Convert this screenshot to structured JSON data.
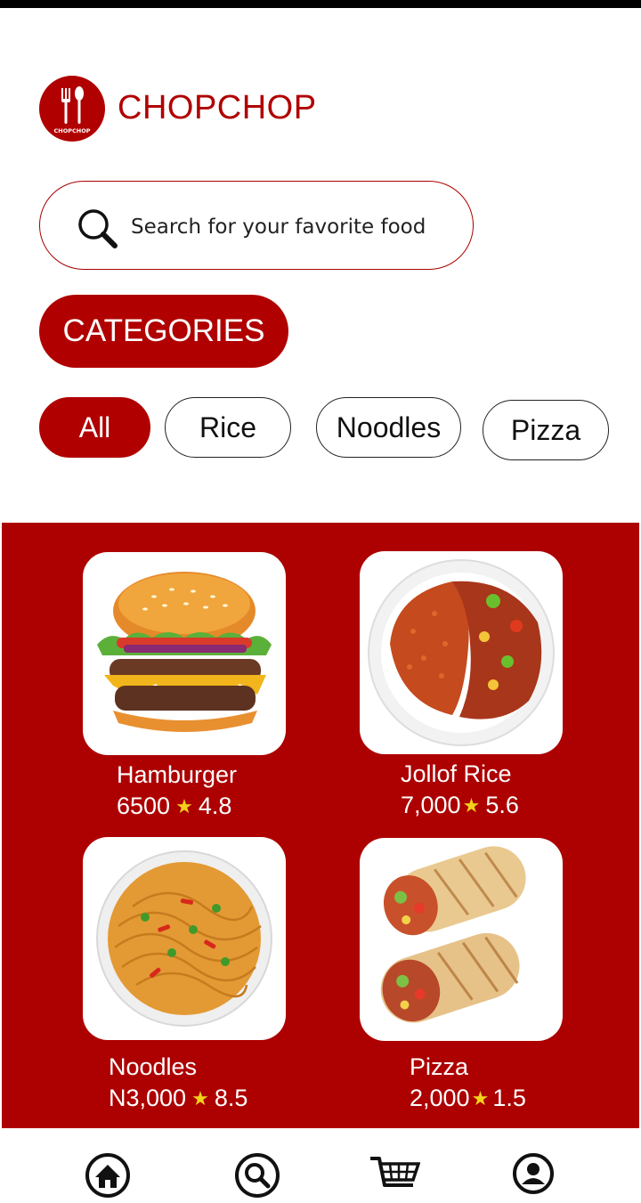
{
  "app": {
    "brand": "CHOPCHOP",
    "logo_text": "CHOPCHOP",
    "accent_color": "#b00000"
  },
  "search": {
    "placeholder": "Search for your favorite food",
    "value": "",
    "icon": "search-icon"
  },
  "categories_label": "CATEGORIES",
  "filters": [
    {
      "label": "All",
      "active": true
    },
    {
      "label": "Rice",
      "active": false
    },
    {
      "label": "Noodles",
      "active": false
    },
    {
      "label": "Pizza",
      "active": false
    }
  ],
  "foods": [
    {
      "name": "Hamburger",
      "price": "6500",
      "rating": "4.8",
      "image": "hamburger"
    },
    {
      "name": "Jollof Rice",
      "price": "7,000",
      "rating": "5.6",
      "image": "jollof-rice"
    },
    {
      "name": "Noodles",
      "price": "N3,000",
      "rating": "8.5",
      "image": "noodles"
    },
    {
      "name": "Pizza",
      "price": "2,000",
      "rating": "1.5",
      "image": "wrap"
    }
  ],
  "nav": [
    {
      "icon": "home-icon"
    },
    {
      "icon": "search-icon"
    },
    {
      "icon": "cart-icon"
    },
    {
      "icon": "profile-icon"
    }
  ]
}
